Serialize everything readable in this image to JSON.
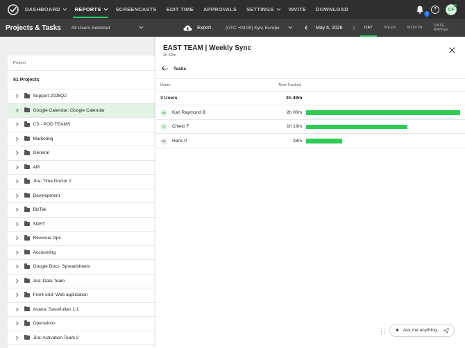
{
  "nav": {
    "items": [
      {
        "label": "DASHBOARD",
        "dropdown": true,
        "active": false
      },
      {
        "label": "REPORTS",
        "dropdown": true,
        "active": true
      },
      {
        "label": "SCREENCASTS",
        "dropdown": false,
        "active": false
      },
      {
        "label": "EDIT TIME",
        "dropdown": false,
        "active": false
      },
      {
        "label": "APPROVALS",
        "dropdown": false,
        "active": false
      },
      {
        "label": "SETTINGS",
        "dropdown": true,
        "active": false
      },
      {
        "label": "INVITE",
        "dropdown": false,
        "active": false
      },
      {
        "label": "DOWNLOAD",
        "dropdown": false,
        "active": false
      }
    ],
    "notifications_count": "1",
    "help_glyph": "?",
    "avatar_initials": "CF"
  },
  "subheader": {
    "title": "Projects & Tasks",
    "users_select": "All Users Selected",
    "export_label": "Export",
    "timezone": "(UTC +03:00) Kyiv, Europe",
    "date": "May 6, 2026",
    "range_tabs": [
      {
        "label": "DAY",
        "active": true
      },
      {
        "label": "WEEK",
        "active": false
      },
      {
        "label": "MONTH",
        "active": false
      },
      {
        "label": "DATE RANGE",
        "active": false
      }
    ]
  },
  "projects": {
    "header": "Project",
    "count_label": "51 Projects",
    "items": [
      {
        "name": "Support 2026Q2",
        "selected": false
      },
      {
        "name": "Google Calendar: Google Calendar",
        "selected": true
      },
      {
        "name": "CS - POD TEAMS",
        "selected": false
      },
      {
        "name": "Marketing",
        "selected": false
      },
      {
        "name": "General",
        "selected": false
      },
      {
        "name": "API",
        "selected": false
      },
      {
        "name": "Jira: Time Doctor 2",
        "selected": false
      },
      {
        "name": "Development",
        "selected": false
      },
      {
        "name": "BizTek",
        "selected": false
      },
      {
        "name": "SDET",
        "selected": false
      },
      {
        "name": "Revenue Ops",
        "selected": false
      },
      {
        "name": "Accounting",
        "selected": false
      },
      {
        "name": "Google Docs: Spreadsheets",
        "selected": false
      },
      {
        "name": "Jira: Data Team",
        "selected": false
      },
      {
        "name": "Front-end: Web application",
        "selected": false
      },
      {
        "name": "Asana: Saso/Iulian 1:1",
        "selected": false
      },
      {
        "name": "Operations",
        "selected": false
      },
      {
        "name": "Jira: Activation Team 2",
        "selected": false
      }
    ]
  },
  "detail": {
    "title": "EAST TEAM | Weekly Sync",
    "subtitle": "3h 49m",
    "back_label": "Tasks",
    "col_users": "Users",
    "col_time": "Time Tracked",
    "total_users": "3 Users",
    "total_time": "3h 49m",
    "users": [
      {
        "initials": "KB",
        "name": "Karl Raymond B",
        "time": "2h 00m",
        "minutes": 120,
        "avatar_bg": "#dff3e3",
        "avatar_fg": "#2e9b4d"
      },
      {
        "initials": "CF",
        "name": "Chielo F",
        "time": "1h 19m",
        "minutes": 79,
        "avatar_bg": "#dff3e3",
        "avatar_fg": "#2e9b4d"
      },
      {
        "initials": "HP",
        "name": "Hans P",
        "time": "28m",
        "minutes": 28,
        "avatar_bg": "#ececec",
        "avatar_fg": "#666666"
      }
    ]
  },
  "assistant": {
    "placeholder": "Ask me anything..."
  },
  "colors": {
    "accent": "#2ecc71",
    "bar": "#2ecc55",
    "selected_row": "#e3f4e6"
  }
}
